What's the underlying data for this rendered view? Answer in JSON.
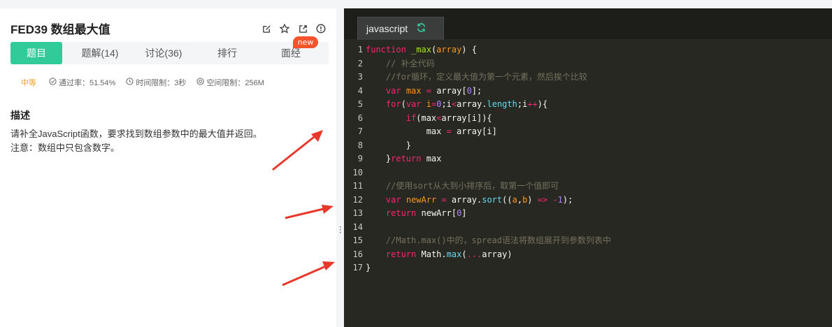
{
  "problem": {
    "title": "FED39  数组最大值",
    "tabs": [
      "题目",
      "题解(14)",
      "讨论(36)",
      "排行",
      "面经"
    ],
    "new_badge": "new",
    "difficulty": "中等",
    "pass_rate": "通过率：51.54%",
    "time_limit": "时间限制：3秒",
    "space_limit": "空间限制：256M",
    "section_title": "描述",
    "description_lines": [
      "请补全JavaScript函数，要求找到数组参数中的最大值并返回。",
      "注意：数组中只包含数字。"
    ]
  },
  "editor": {
    "language": "javascript",
    "line_numbers": [
      "1",
      "2",
      "3",
      "4",
      "5",
      "6",
      "7",
      "8",
      "9",
      "10",
      "11",
      "12",
      "13",
      "14",
      "15",
      "16",
      "17"
    ]
  },
  "colors": {
    "accent": "#32ca99",
    "badge": "#f4532c",
    "difficulty": "#f0a22a",
    "editor_bg": "#272822",
    "arrow": "#e8382b"
  },
  "icons": [
    "edit-icon",
    "star-icon",
    "share-icon",
    "info-icon",
    "check-circle-icon",
    "clock-icon",
    "memory-icon",
    "refresh-icon",
    "drag-handle-icon"
  ]
}
